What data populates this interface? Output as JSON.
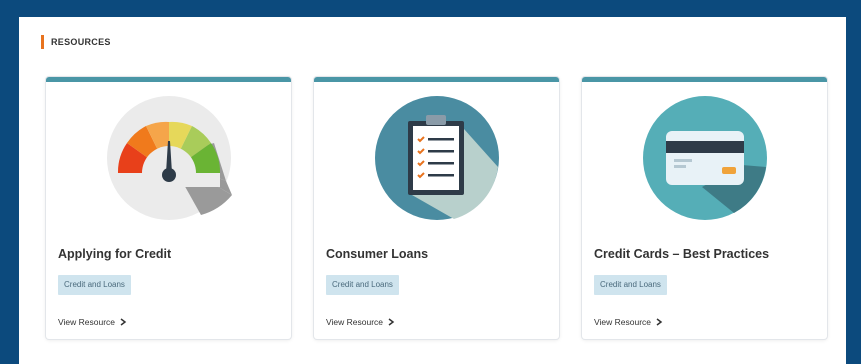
{
  "section": {
    "title": "RESOURCES"
  },
  "cards": [
    {
      "title": "Applying for Credit",
      "tag": "Credit and Loans",
      "link": "View Resource",
      "icon": "speedometer-gauge-icon"
    },
    {
      "title": "Consumer Loans",
      "tag": "Credit and Loans",
      "link": "View Resource",
      "icon": "clipboard-checklist-icon"
    },
    {
      "title": "Credit Cards – Best Practices",
      "tag": "Credit and Loans",
      "link": "View Resource",
      "icon": "credit-card-icon"
    }
  ],
  "colors": {
    "page_border": "#0c4a7d",
    "accent_bar": "#e8731e",
    "card_top": "#4a96a6",
    "tag_bg": "#cfe4ee"
  }
}
